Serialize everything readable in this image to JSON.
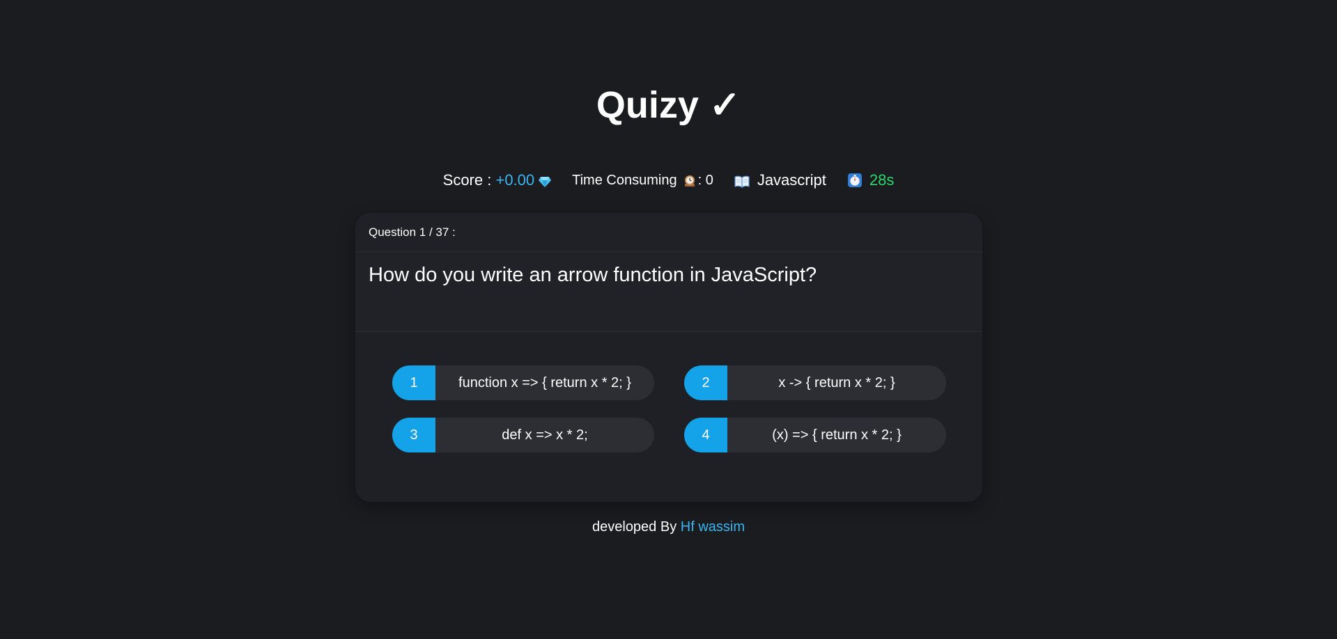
{
  "app": {
    "title": "Quizy",
    "title_mark": "✓"
  },
  "stats": {
    "score_label": "Score :",
    "score_value": "+0.00",
    "score_icon": "gem-icon",
    "time_label": "Time Consuming",
    "time_icon": "clock-icon",
    "time_sep": ":",
    "time_value": "0",
    "category_icon": "book-icon",
    "category": "Javascript",
    "timer_icon": "timer-icon",
    "timer_value": "28s"
  },
  "question": {
    "header": "Question 1 / 37 :",
    "text": "How do you write an arrow function in JavaScript?"
  },
  "answers": [
    {
      "num": "1",
      "text": "function x => { return x * 2; }"
    },
    {
      "num": "2",
      "text": "x -> { return x * 2; }"
    },
    {
      "num": "3",
      "text": "def x => x * 2;"
    },
    {
      "num": "4",
      "text": "(x) => { return x * 2; }"
    }
  ],
  "footer": {
    "prefix": "developed By",
    "author": "Hf wassim"
  },
  "colors": {
    "background": "#1b1c20",
    "card": "#202126",
    "accent": "#3bb4f2",
    "answer_badge": "#14a3e8",
    "timer": "#2bd96a"
  }
}
